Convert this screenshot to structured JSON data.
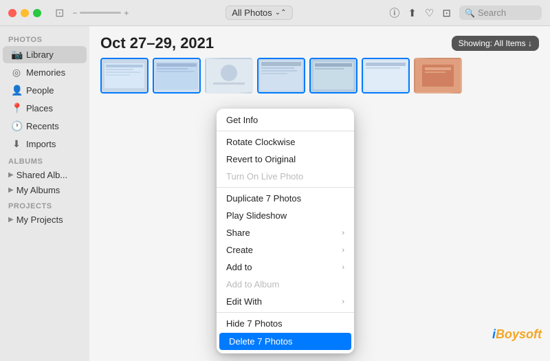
{
  "titlebar": {
    "traffic_lights": [
      "close",
      "minimize",
      "maximize"
    ],
    "controls": {
      "frame_icon": "⊡",
      "plus_icon": "+"
    },
    "dropdown": {
      "label": "All Photos",
      "arrow": "⌃"
    },
    "actions": {
      "info_icon": "ⓘ",
      "share_icon": "⬆",
      "heart_icon": "♡",
      "crop_icon": "⊡"
    },
    "search": {
      "placeholder": "Search",
      "icon": "🔍"
    }
  },
  "sidebar": {
    "photos_section": "Photos",
    "items": [
      {
        "id": "library",
        "label": "Library",
        "icon": "📷",
        "active": true
      },
      {
        "id": "memories",
        "label": "Memories",
        "icon": "◎"
      },
      {
        "id": "people",
        "label": "People",
        "icon": "👤"
      },
      {
        "id": "places",
        "label": "Places",
        "icon": "📍"
      },
      {
        "id": "recents",
        "label": "Recents",
        "icon": "🕐"
      },
      {
        "id": "imports",
        "label": "Imports",
        "icon": "⬇"
      }
    ],
    "albums_section": "Albums",
    "album_items": [
      {
        "id": "shared-albums",
        "label": "Shared Alb..."
      },
      {
        "id": "my-albums",
        "label": "My Albums"
      }
    ],
    "projects_section": "Projects",
    "project_items": [
      {
        "id": "my-projects",
        "label": "My Projects"
      }
    ]
  },
  "content": {
    "date_title": "Oct 27–29, 2021",
    "showing_label": "Showing: All Items ↓",
    "photo_count": "7 Photos",
    "thumbnails": [
      {
        "id": 1,
        "style": "thumb-1",
        "selected": true
      },
      {
        "id": 2,
        "style": "thumb-2",
        "selected": true
      },
      {
        "id": 3,
        "style": "thumb-3",
        "selected": false
      },
      {
        "id": 4,
        "style": "thumb-4",
        "selected": true
      },
      {
        "id": 5,
        "style": "thumb-5",
        "selected": true
      },
      {
        "id": 6,
        "style": "thumb-6",
        "selected": true
      },
      {
        "id": 7,
        "style": "thumb-7",
        "selected": false
      }
    ]
  },
  "context_menu": {
    "items": [
      {
        "id": "get-info",
        "label": "Get Info",
        "type": "normal"
      },
      {
        "id": "separator-1",
        "type": "separator"
      },
      {
        "id": "rotate-clockwise",
        "label": "Rotate Clockwise",
        "type": "normal"
      },
      {
        "id": "revert-to-original",
        "label": "Revert to Original",
        "type": "normal"
      },
      {
        "id": "turn-on-live-photo",
        "label": "Turn On Live Photo",
        "type": "disabled"
      },
      {
        "id": "separator-2",
        "type": "separator"
      },
      {
        "id": "duplicate",
        "label": "Duplicate 7 Photos",
        "type": "normal"
      },
      {
        "id": "play-slideshow",
        "label": "Play Slideshow",
        "type": "normal"
      },
      {
        "id": "share",
        "label": "Share",
        "type": "submenu"
      },
      {
        "id": "create",
        "label": "Create",
        "type": "submenu"
      },
      {
        "id": "add-to",
        "label": "Add to",
        "type": "submenu"
      },
      {
        "id": "add-to-album",
        "label": "Add to Album",
        "type": "disabled"
      },
      {
        "id": "edit-with",
        "label": "Edit With",
        "type": "submenu"
      },
      {
        "id": "separator-3",
        "type": "separator"
      },
      {
        "id": "hide-photos",
        "label": "Hide 7 Photos",
        "type": "normal"
      },
      {
        "id": "delete-photos",
        "label": "Delete 7 Photos",
        "type": "highlighted"
      }
    ]
  },
  "watermark": {
    "i": "i",
    "boysoft": "Boysoft"
  }
}
